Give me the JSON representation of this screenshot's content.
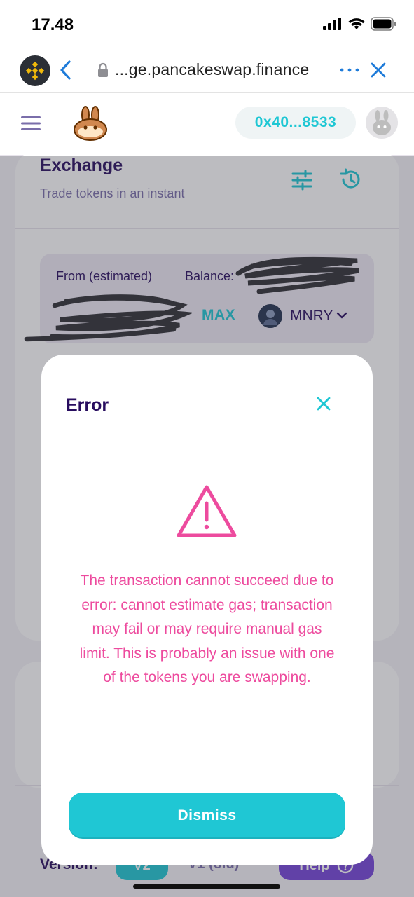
{
  "status_bar": {
    "time": "17.48"
  },
  "browser": {
    "url": "...ge.pancakeswap.finance"
  },
  "nav": {
    "account": "0x40...8533"
  },
  "exchange": {
    "title": "Exchange",
    "subtitle": "Trade tokens in an instant",
    "from_label": "From (estimated)",
    "balance_label": "Balance:",
    "max_label": "MAX",
    "token": "MNRY"
  },
  "footer": {
    "version_label": "Version:",
    "v2": "V2",
    "v1": "V1 (old)",
    "help": "Help"
  },
  "modal": {
    "title": "Error",
    "message": "The transaction cannot succeed due to error: cannot estimate gas; transaction may fail or may require manual gas limit. This is probably an issue with one of the tokens you are swapping.",
    "dismiss": "Dismiss"
  },
  "colors": {
    "primary": "#1fc7d4",
    "text_dark": "#280d5f",
    "text_sub": "#7a6eaa",
    "error": "#ed4b9e",
    "help": "#7645d9"
  },
  "icons": [
    "binance-logo-icon",
    "back-icon",
    "lock-icon",
    "more-icon",
    "close-icon",
    "menu-icon",
    "pancake-logo-icon",
    "avatar-bunny-icon",
    "settings-sliders-icon",
    "history-icon",
    "chevron-down-icon",
    "warning-triangle-icon"
  ]
}
